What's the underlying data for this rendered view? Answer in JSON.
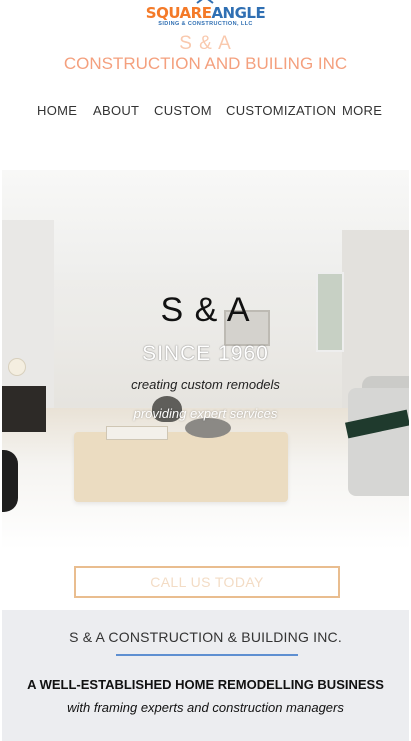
{
  "logo": {
    "word_part1": "SQUARE",
    "word_part2": "ANGLE",
    "tagline": "SIDING & CONSTRUCTION, LLC"
  },
  "header": {
    "brand": "S & A",
    "company": "CONSTRUCTION AND BUILING INC"
  },
  "nav": {
    "items": [
      "HOME",
      "ABOUT",
      "CUSTOM",
      "CUSTOMIZATION",
      "MORE"
    ]
  },
  "hero": {
    "title": "S & A",
    "since": "SINCE 1960",
    "tagline1": "creating custom remodels",
    "tagline2": "providing expert services"
  },
  "cta": {
    "label": "CALL US TODAY"
  },
  "about": {
    "title": "S & A CONSTRUCTION & BUILDING INC.",
    "headline": "A WELL-ESTABLISHED HOME REMODELLING BUSINESS",
    "subline": "with framing experts and construction managers"
  },
  "colors": {
    "accent_orange": "#f47a28",
    "accent_blue": "#2f6fb3",
    "company_salmon": "#f4a07e",
    "cta_border": "#e9bd8f",
    "rule_blue": "#5e8fd1",
    "about_bg": "#ecedf0"
  }
}
